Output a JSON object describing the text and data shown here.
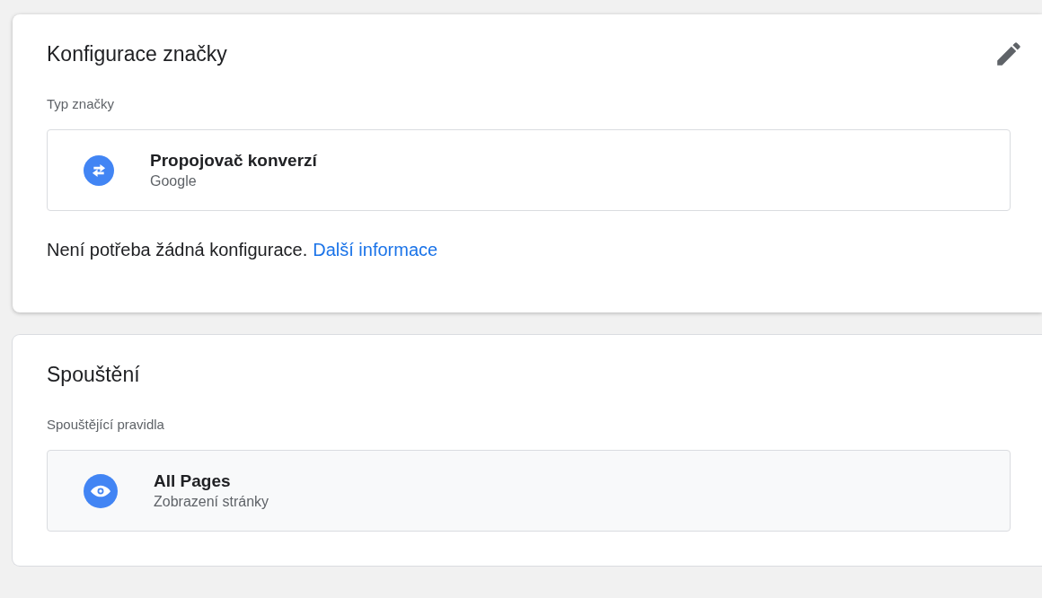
{
  "sections": [
    {
      "kind": "configuration",
      "title": "Konfigurace značky",
      "label": "Typ značky",
      "item": {
        "name": "Propojovač konverzí",
        "subtitle": "Google"
      },
      "note": {
        "text": "Není potřeba žádná konfigurace.",
        "link": "Další informace"
      }
    },
    {
      "kind": "triggering",
      "title": "Spouštění",
      "label": "Spouštějící pravidla",
      "item": {
        "name": "All Pages",
        "subtitle": "Zobrazení stránky"
      }
    }
  ]
}
